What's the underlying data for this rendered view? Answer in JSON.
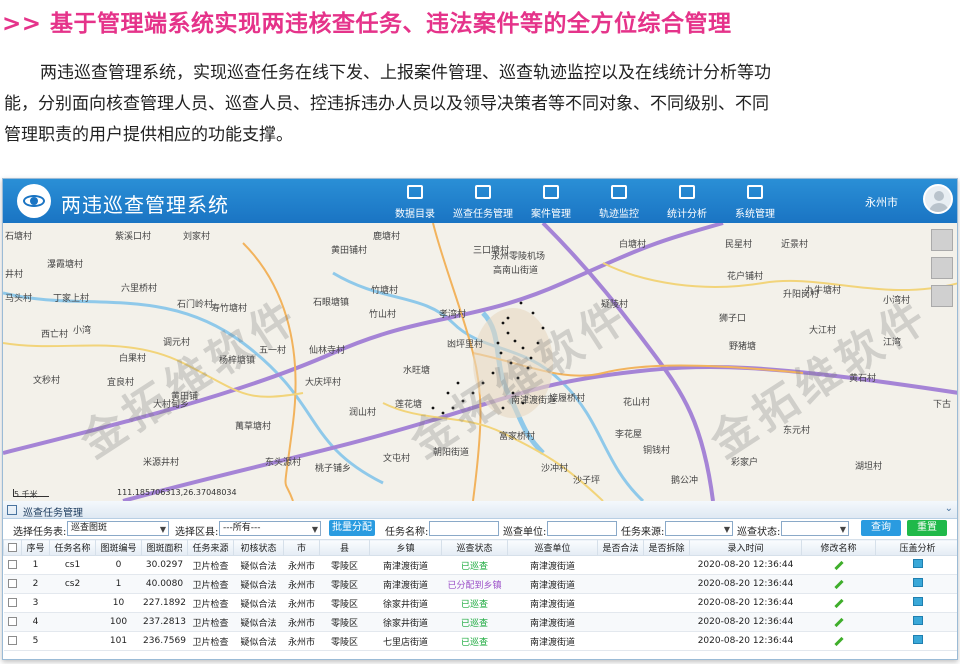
{
  "headline": ">> 基于管理端系统实现两违核查任务、违法案件等的全方位综合管理",
  "intro": [
    "两违巡查管理系统，实现巡查任务在线下发、上报案件管理、巡查轨迹监控以及在线统计分析等功",
    "能，分别面向核查管理人员、巡查人员、控违拆违办人员以及领导决策者等不同对象、不同级别、不同",
    "管理职责的用户提供相应的功能支撑。"
  ],
  "app": {
    "title": "两违巡查管理系统",
    "nav": [
      {
        "label": "数据目录",
        "icon": "layers-icon"
      },
      {
        "label": "巡查任务管理",
        "icon": "task-list-icon"
      },
      {
        "label": "案件管理",
        "icon": "gavel-icon"
      },
      {
        "label": "轨迹监控",
        "icon": "car-icon"
      },
      {
        "label": "统计分析",
        "icon": "bar-chart-icon"
      },
      {
        "label": "系统管理",
        "icon": "monitor-icon"
      }
    ],
    "region": "永州市",
    "colors": {
      "header": "#1a74c3",
      "accent": "#e5338a",
      "btn_blue": "#2a9be0",
      "btn_green": "#1fb94a"
    }
  },
  "map": {
    "labels": [
      "石塘村",
      "紫溪口村",
      "刘家村",
      "黄田铺村",
      "鹿塘村",
      "三口塘村",
      "白塘村",
      "民星村",
      "近景村",
      "井村",
      "瀑霞塘村",
      "竹塘村",
      "永州零陵机场",
      "高南山街道",
      "花户铺村",
      "九牛塘村",
      "丁家上村",
      "马头村",
      "六里桥村",
      "石门岭村",
      "寿竹塘村",
      "石眼塘镇",
      "竹山村",
      "孝湾村",
      "疑陵村",
      "升阳岗村",
      "小湾",
      "西亡村",
      "调元村",
      "五一村",
      "仙林寺村",
      "凼坪里村",
      "野猪塘",
      "大江村",
      "白果村",
      "杨梓塘镇",
      "文秒村",
      "宜良村",
      "大庆坪村",
      "南津渡街道",
      "花山村",
      "黄石村",
      "水旺塘",
      "大村甸乡",
      "润山村",
      "莲花塘",
      "接履桥村",
      "黄田铺",
      "萬草塘村",
      "富家桥村",
      "李花屋",
      "朝阳街道",
      "文屯村",
      "沙冲村",
      "东头源村",
      "米源井村",
      "桃子铺乡",
      "彩家户",
      "湖坦村",
      "沙子坪",
      "鹅公冲",
      "小湾村",
      "铜钱村",
      "东元村",
      "狮子口",
      "下古",
      "江湾"
    ],
    "watermark": "金拓维软件",
    "scale": "5 千米",
    "coordinates": "111.185706313,26.37048034"
  },
  "tasks": {
    "panel_title": "巡查任务管理",
    "filters": {
      "task_table_label": "选择任务表:",
      "task_table_value": "巡查图斑",
      "region_label": "选择区县:",
      "region_value": "---所有---",
      "batch_assign": "批量分配",
      "task_name_label": "任务名称:",
      "unit_label": "巡查单位:",
      "source_label": "任务来源:",
      "status_label": "巡查状态:",
      "query": "查询",
      "reset": "重置"
    },
    "columns": [
      "序号",
      "任务名称",
      "图斑编号",
      "图斑面积",
      "任务来源",
      "初核状态",
      "市",
      "县",
      "乡镇",
      "巡查状态",
      "巡查单位",
      "是否合法",
      "是否拆除",
      "录入时间",
      "修改名称",
      "压盖分析"
    ],
    "rows": [
      {
        "no": "1",
        "name": "cs1",
        "code": "0",
        "area": "30.0297",
        "source": "卫片检查",
        "check": "疑似合法",
        "city": "永州市",
        "county": "零陵区",
        "town": "南津渡街道",
        "status": "已巡查",
        "unit": "南津渡街道",
        "legal": "",
        "demolished": "",
        "time": "2020-08-20 12:36:44"
      },
      {
        "no": "2",
        "name": "cs2",
        "code": "1",
        "area": "40.0080",
        "source": "卫片检查",
        "check": "疑似合法",
        "city": "永州市",
        "county": "零陵区",
        "town": "南津渡街道",
        "status": "已分配到乡镇",
        "unit": "南津渡街道",
        "legal": "",
        "demolished": "",
        "time": "2020-08-20 12:36:44"
      },
      {
        "no": "3",
        "name": "",
        "code": "10",
        "area": "227.1892",
        "source": "卫片检查",
        "check": "疑似合法",
        "city": "永州市",
        "county": "零陵区",
        "town": "徐家井街道",
        "status": "已巡查",
        "unit": "南津渡街道",
        "legal": "",
        "demolished": "",
        "time": "2020-08-20 12:36:44"
      },
      {
        "no": "4",
        "name": "",
        "code": "100",
        "area": "237.2813",
        "source": "卫片检查",
        "check": "疑似合法",
        "city": "永州市",
        "county": "零陵区",
        "town": "徐家井街道",
        "status": "已巡查",
        "unit": "南津渡街道",
        "legal": "",
        "demolished": "",
        "time": "2020-08-20 12:36:44"
      },
      {
        "no": "5",
        "name": "",
        "code": "101",
        "area": "236.7569",
        "source": "卫片检查",
        "check": "疑似合法",
        "city": "永州市",
        "county": "零陵区",
        "town": "七里店街道",
        "status": "已巡查",
        "unit": "南津渡街道",
        "legal": "",
        "demolished": "",
        "time": "2020-08-20 12:36:44"
      }
    ]
  }
}
